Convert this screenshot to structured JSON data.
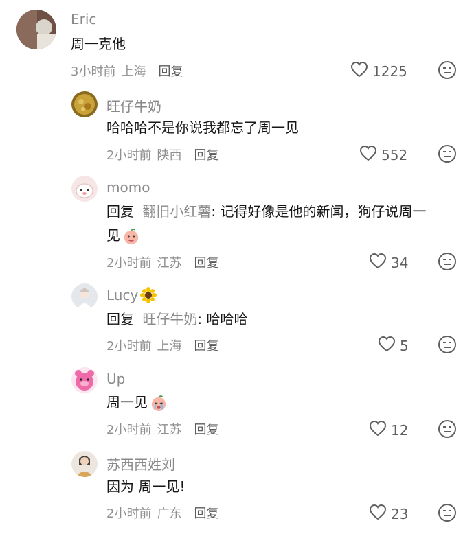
{
  "comments": [
    {
      "username": "Eric",
      "text": "周一克他",
      "time": "3小时前",
      "location": "上海",
      "reply": "回复",
      "likes": "1225",
      "avatar_color": "#7a5a4a"
    },
    {
      "username": "旺仔牛奶",
      "text": "哈哈哈不是你说我都忘了周一见",
      "time": "2小时前",
      "location": "陕西",
      "reply": "回复",
      "likes": "552",
      "avatar_color": "#b08a2a"
    },
    {
      "username": "momo",
      "reply_prefix": "回复",
      "mention": "翻旧小红薯",
      "text": ": 记得好像是他的新闻，狗仔说周一",
      "text_line2": "见",
      "emoji": "peach-face-emoji",
      "time": "2小时前",
      "location": "江苏",
      "reply": "回复",
      "likes": "34",
      "avatar_color": "#f2dede"
    },
    {
      "username": "Lucy",
      "username_emoji": "sunflower-emoji",
      "reply_prefix": "回复",
      "mention": "旺仔牛奶",
      "text": ": 哈哈哈",
      "time": "2小时前",
      "location": "上海",
      "reply": "回复",
      "likes": "5",
      "avatar_color": "#d9dde3"
    },
    {
      "username": "Up",
      "text": "周一见",
      "emoji": "crying-peach-emoji",
      "time": "2小时前",
      "location": "江苏",
      "reply": "回复",
      "likes": "12",
      "avatar_color": "#e85a9a"
    },
    {
      "username": "苏西西姓刘",
      "text": "因为 周一见!",
      "time": "2小时前",
      "location": "广东",
      "reply": "回复",
      "likes": "23",
      "avatar_color": "#c9a98f"
    }
  ],
  "icons": {
    "like": "heart-outline-icon",
    "dislike": "meh-face-icon"
  },
  "colors": {
    "username": "#8a8a8a",
    "text": "#161616",
    "meta": "#8f8f8f",
    "icon": "#5f5f5f"
  }
}
